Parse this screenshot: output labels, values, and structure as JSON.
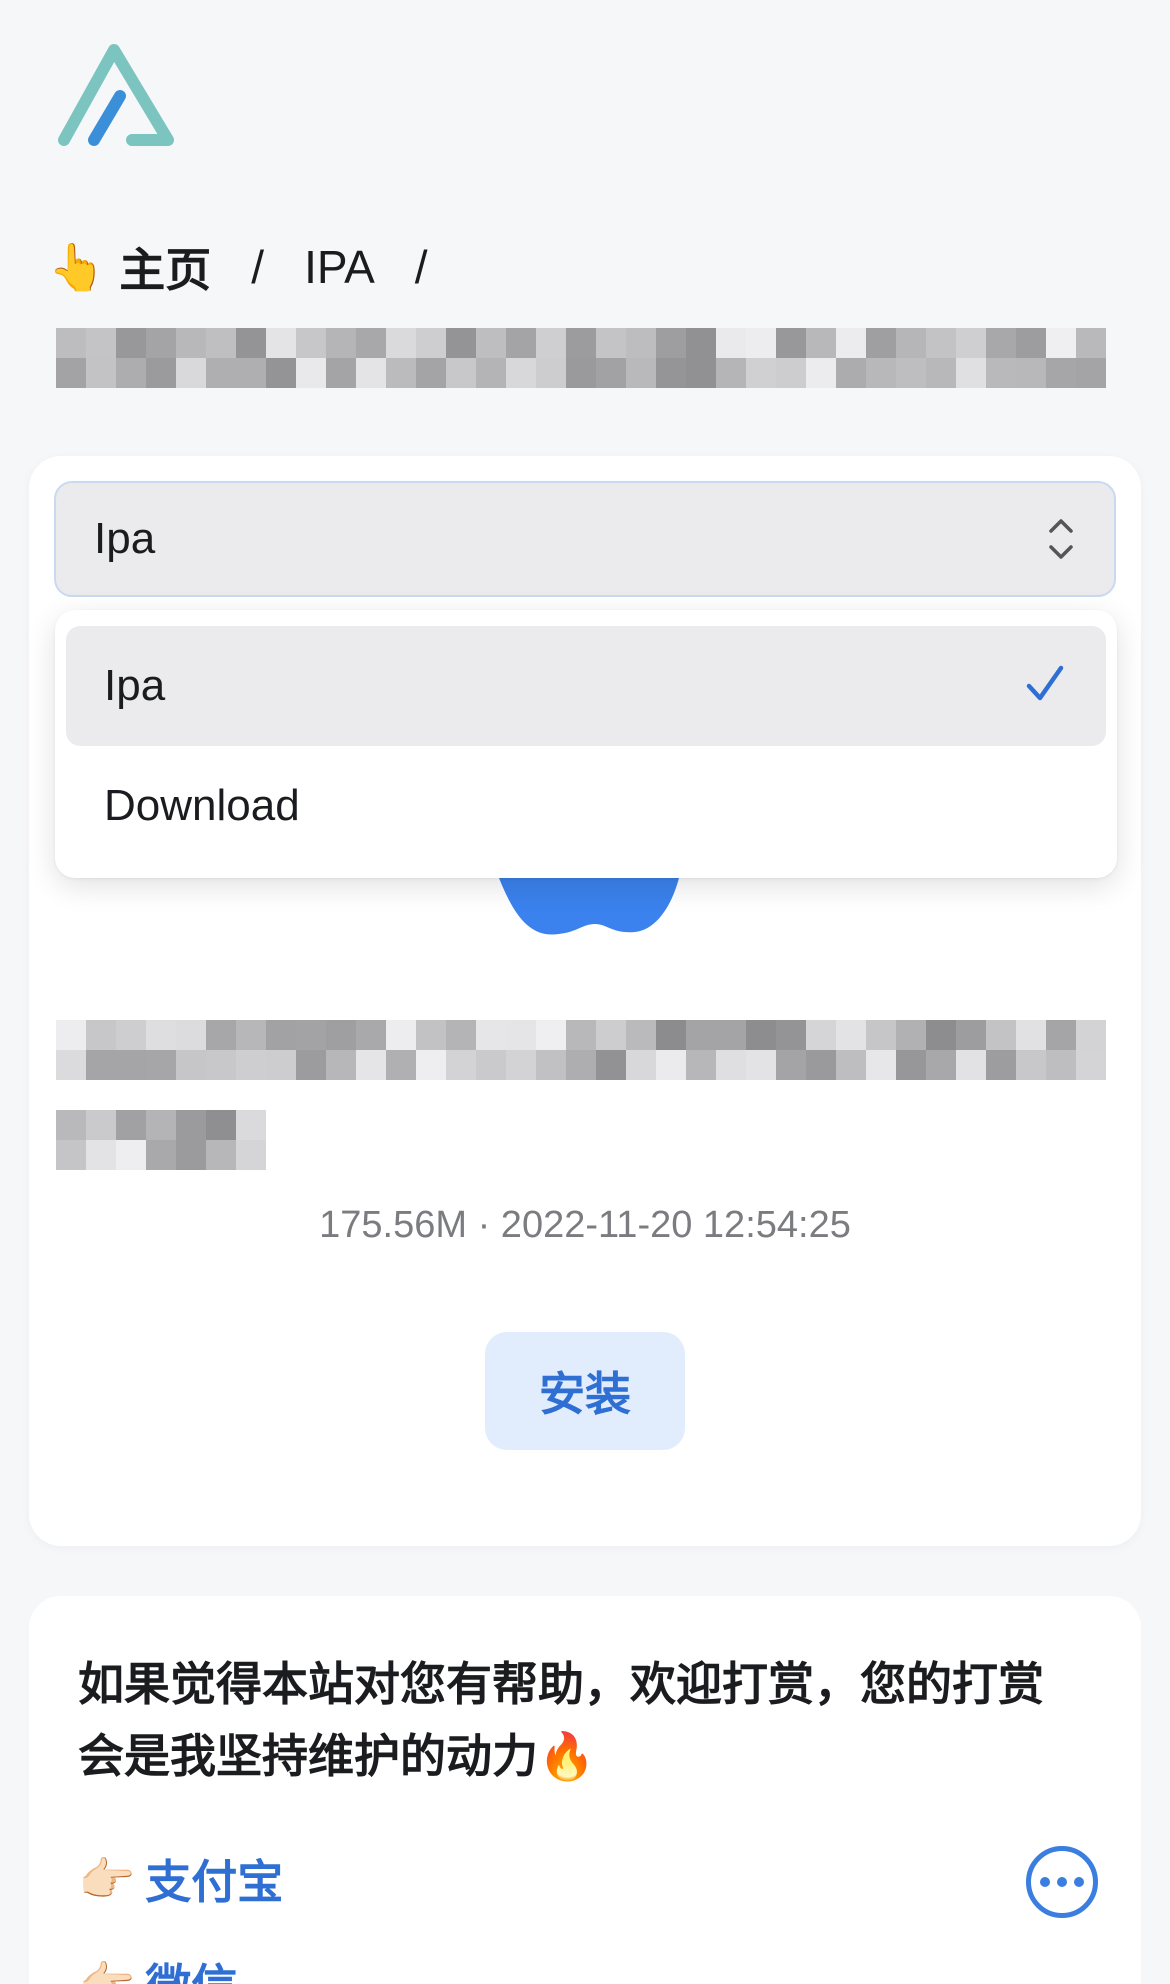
{
  "breadcrumb": {
    "emoji": "👆",
    "home": "主页",
    "separator": "/",
    "section": "IPA"
  },
  "select": {
    "value": "Ipa",
    "options": [
      "Ipa",
      "Download"
    ]
  },
  "app": {
    "meta": "175.56M · 2022-11-20 12:54:25",
    "install_label": "安装"
  },
  "donate": {
    "message": "如果觉得本站对您有帮助，欢迎打赏，您的打赏会是我坚持维护的动力🔥",
    "alipay_emoji": "👉🏻",
    "alipay_label": "支付宝",
    "wechat_emoji": "👉🏻",
    "wechat_label": "微信"
  },
  "colors": {
    "accent": "#2f6fd4",
    "logo_teal": "#7cc4bf",
    "logo_blue": "#3b8fd9",
    "select_bg": "#ebebed",
    "install_bg": "#e1edfd"
  },
  "icons": {
    "logo": "app-logo",
    "chevron": "chevron-up-down-icon",
    "check": "checkmark-icon",
    "more": "more-icon"
  }
}
